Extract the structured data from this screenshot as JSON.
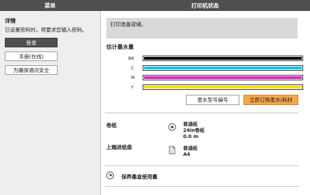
{
  "header": {
    "menu_title": "菜单",
    "status_title": "打印机状态"
  },
  "left_panel": {
    "detail_title": "详情",
    "password_message": "已设置密码时，将要求您输入密码。",
    "buttons": {
      "login": "登录",
      "manual": "手册(在线)",
      "security": "为确保通讯安全"
    }
  },
  "status": {
    "message": "打印准备就绪。"
  },
  "ink": {
    "title": "估计墨水量",
    "levels": [
      {
        "label": "BK",
        "color": "#000000",
        "level": 1.0
      },
      {
        "label": "C",
        "color": "#00c8e8",
        "level": 1.0
      },
      {
        "label": "M",
        "color": "#e020c8",
        "level": 1.0
      },
      {
        "label": "Y",
        "color": "#f7e100",
        "level": 1.0
      }
    ],
    "model_button": "墨水型号编号",
    "buy_button": "立即订购墨水/耗材"
  },
  "feeds": {
    "roll": {
      "label": "卷纸",
      "icon": "roll-paper-icon",
      "lines": [
        "普通纸",
        "24in卷纸",
        "0.0 m"
      ]
    },
    "upper_cassette": {
      "label": "上端进纸盘",
      "icon": "sheet-paper-icon",
      "lines": [
        "普通纸",
        "A4"
      ]
    }
  },
  "save_cartridge": {
    "label": "保养墨盒使用量",
    "icon": "play-icon"
  }
}
